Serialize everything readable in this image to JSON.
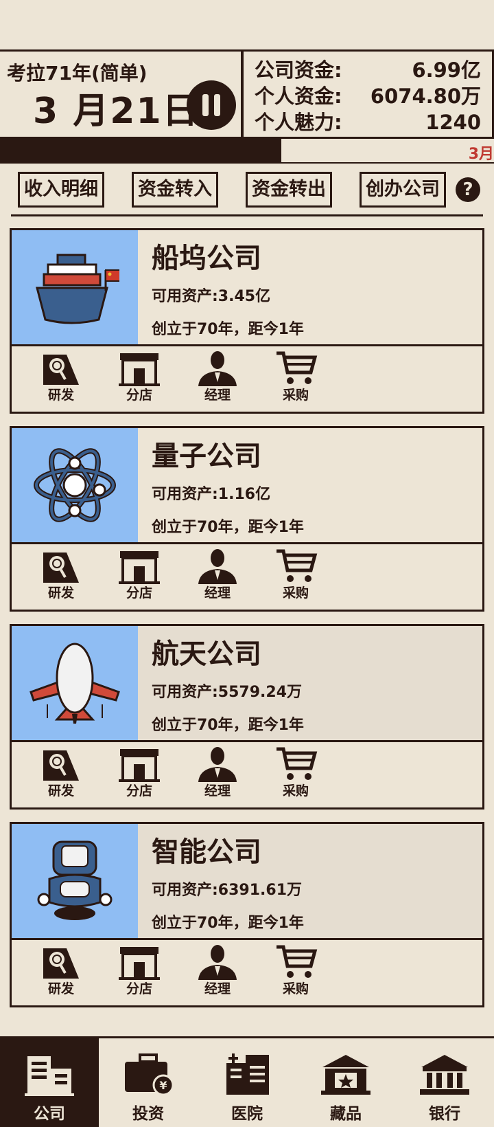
{
  "header": {
    "year_label": "考拉71年(简单)",
    "date": "3 月21日",
    "funds": [
      {
        "label": "公司资金:",
        "value": "6.99亿"
      },
      {
        "label": "个人资金:",
        "value": "6074.80万"
      },
      {
        "label": "个人魅力:",
        "value": "1240"
      }
    ]
  },
  "progress": {
    "label": "3月",
    "fraction": 0.57
  },
  "actions": [
    "收入明细",
    "资金转入",
    "资金转出",
    "创办公司"
  ],
  "help_glyph": "?",
  "companies": [
    {
      "name": "船坞公司",
      "assets": "可用资产:3.45亿",
      "founded": "创立于70年，距今1年",
      "icon": "ship-icon"
    },
    {
      "name": "量子公司",
      "assets": "可用资产:1.16亿",
      "founded": "创立于70年，距今1年",
      "icon": "atom-icon"
    },
    {
      "name": "航天公司",
      "assets": "可用资产:5579.24万",
      "founded": "创立于70年，距今1年",
      "icon": "jet-icon"
    },
    {
      "name": "智能公司",
      "assets": "可用资产:6391.61万",
      "founded": "创立于70年，距今1年",
      "icon": "robot-icon"
    }
  ],
  "tools": [
    {
      "label": "研发",
      "icon": "research-icon"
    },
    {
      "label": "分店",
      "icon": "store-icon"
    },
    {
      "label": "经理",
      "icon": "manager-icon"
    },
    {
      "label": "采购",
      "icon": "cart-icon"
    }
  ],
  "nav": [
    {
      "label": "公司",
      "icon": "company-icon",
      "active": true
    },
    {
      "label": "投资",
      "icon": "briefcase-icon",
      "active": false
    },
    {
      "label": "医院",
      "icon": "hospital-icon",
      "active": false
    },
    {
      "label": "藏品",
      "icon": "museum-icon",
      "active": false
    },
    {
      "label": "银行",
      "icon": "bank-icon",
      "active": false
    }
  ],
  "colors": {
    "dark": "#2a1812",
    "paper": "#ede5d6",
    "card_image_bg": "#8fbdf3",
    "accent_red": "#c03a32"
  }
}
